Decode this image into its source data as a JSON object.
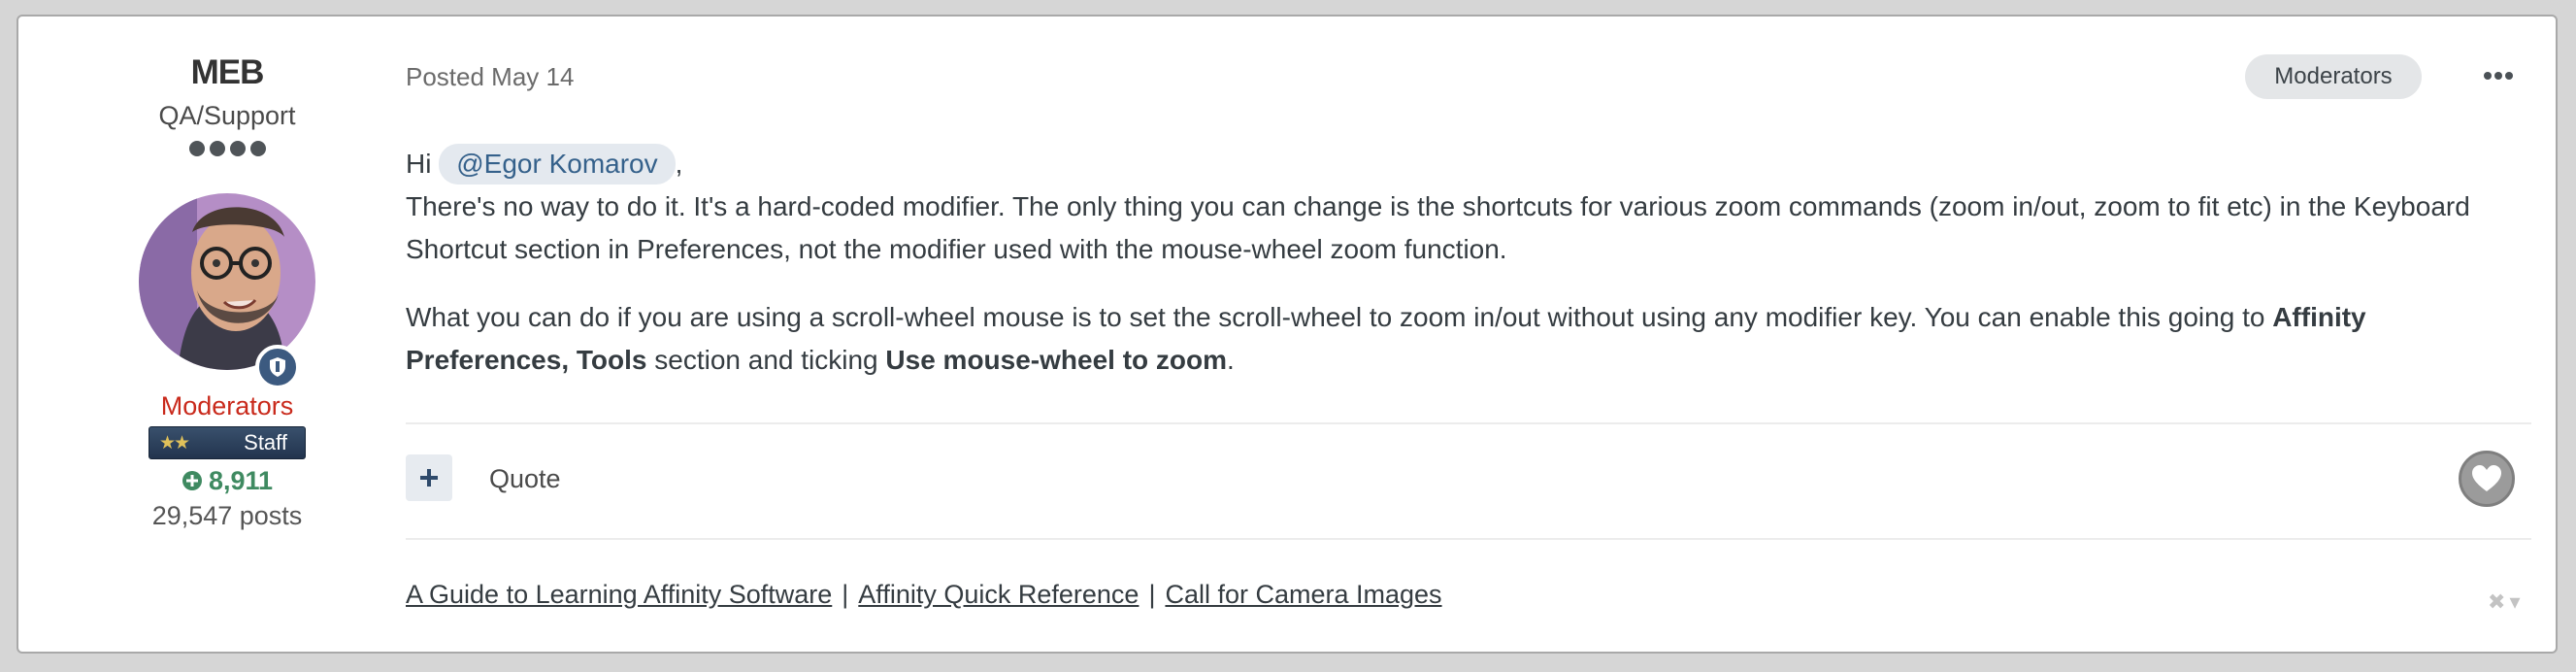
{
  "author": {
    "name": "MEB",
    "title": "QA/Support",
    "group": "Moderators",
    "badge_label": "Staff",
    "reputation": "8,911",
    "posts": "29,547 posts",
    "rank_pips": 4
  },
  "post": {
    "meta": "Posted May 14",
    "tag": "Moderators",
    "greeting": "Hi",
    "mention": "@Egor Komarov",
    "after_mention": ",",
    "line1": "There's no way to do it. It's a hard-coded modifier. The only thing you can change is the shortcuts for various zoom commands (zoom in/out, zoom to fit etc) in the Keyboard Shortcut section in Preferences, not the modifier used with the mouse-wheel zoom function.",
    "para2_a": "What you can do if you are using a scroll-wheel mouse is to set the scroll-wheel to zoom in/out without using any modifier key. You can enable this going to",
    "para2_bold1": "Affinity Preferences, Tools",
    "para2_b": "section and ticking",
    "para2_bold2": "Use mouse-wheel to zoom",
    "para2_end": "."
  },
  "actions": {
    "quote_label": "Quote"
  },
  "signature": {
    "links": [
      "A Guide to Learning Affinity Software",
      "Affinity Quick Reference",
      "Call for Camera Images"
    ],
    "separator": "|"
  },
  "colors": {
    "group": "#c92a1c",
    "reputation": "#3f8a61",
    "mention_bg": "#e4e9ef",
    "mention_text": "#35618b",
    "badge_bg": "#2c4260"
  },
  "icons": {
    "reputation": "plus-circle-icon",
    "quote": "plus-icon",
    "like": "heart-icon",
    "more": "ellipsis-icon",
    "moderator": "shield-icon",
    "signature_toggle": "close-icon"
  }
}
